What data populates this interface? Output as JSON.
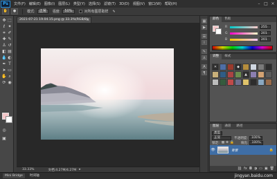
{
  "app": {
    "logo": "Ps"
  },
  "menubar": {
    "items": [
      "文件(F)",
      "编辑(E)",
      "图像(I)",
      "图层(L)",
      "类型(Y)",
      "选择(S)",
      "滤镜(T)",
      "3D(D)",
      "视图(V)",
      "窗口(W)",
      "帮助(H)"
    ],
    "window_controls": [
      "–",
      "□",
      "×"
    ]
  },
  "options": {
    "tool_glyph": "✋",
    "mode_label": "模式:",
    "mode_value": "正常",
    "opacity_label": "强度:",
    "opacity_value": "50%",
    "sample_all_layers": "对所有图层取样"
  },
  "document": {
    "tab_title": "2021-07-21 19.04.15.png @ 33.3%(RGB/8)",
    "close_glyph": "×",
    "zoom": "33.33%",
    "doc_size": "文档:4.27M/4.27M"
  },
  "color_panel": {
    "tabs": [
      "颜色",
      "色板"
    ],
    "rgb": [
      {
        "channel": "R",
        "value": "255"
      },
      {
        "channel": "G",
        "value": "201"
      },
      {
        "channel": "B",
        "value": "201"
      }
    ],
    "foreground": "#f3c6c8",
    "background": "#ffffff"
  },
  "adjustments_panel": {
    "tabs": [
      "调整",
      "样式"
    ]
  },
  "layers_panel": {
    "tabs": [
      "图层",
      "通道",
      "路径"
    ],
    "kind_label": "类型",
    "blend_mode": "正常",
    "opacity_label": "不透明度:",
    "opacity": "100%",
    "lock_label": "锁定:",
    "fill_label": "填充:",
    "fill": "100%",
    "layer_name": "背景"
  },
  "bottombar": {
    "tabs": [
      "Mini Bridge",
      "时间轴"
    ],
    "watermark": "jingyan.baidu.com"
  }
}
